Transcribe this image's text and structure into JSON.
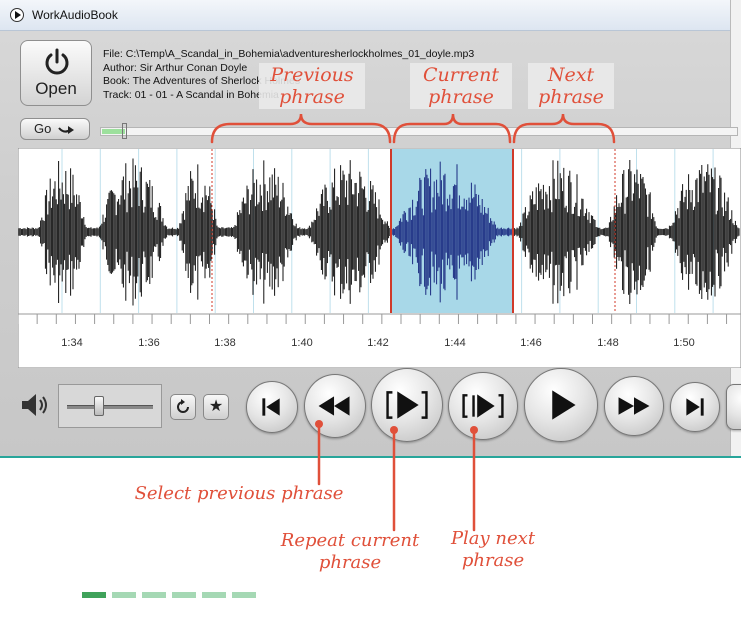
{
  "window": {
    "title": "WorkAudioBook"
  },
  "toolbar": {
    "open_label": "Open",
    "go_label": "Go"
  },
  "file_info": {
    "file": "File:  C:\\Temp\\A_Scandal_in_Bohemia\\adventuresherlockholmes_01_doyle.mp3",
    "author": "Author:  Sir Arthur Conan Doyle",
    "book": "Book:  The Adventures of Sherlock Holmes",
    "track": "Track:  01 - 01 - A Scandal in Bohemia"
  },
  "timeline": {
    "ticks": [
      "1:34",
      "1:36",
      "1:38",
      "1:40",
      "1:42",
      "1:44",
      "1:46",
      "1:48",
      "1:50"
    ]
  },
  "colors": {
    "accent": "#e0503a",
    "selection": "#a8d8e8",
    "wave": "#111111",
    "wave_current": "#1a2a80",
    "divider": "#27a59a"
  },
  "annotations": {
    "previous": "Previous\nphrase",
    "current": "Current\nphrase",
    "next": "Next\nphrase",
    "select_previous": "Select previous phrase",
    "repeat_current": "Repeat current\nphrase",
    "play_next": "Play next\nphrase"
  },
  "icons": {
    "open": "power-icon",
    "go": "arrow-right-icon",
    "volume": "speaker-icon",
    "loop": "loop-icon",
    "bookmark": "star-icon",
    "first": "skip-to-start-icon",
    "previous": "rewind-icon",
    "repeat": "repeat-phrase-icon",
    "play_next": "play-next-phrase-icon",
    "play": "play-icon",
    "forward": "fast-forward-icon",
    "last": "skip-to-end-icon"
  },
  "volume": {
    "level": 0.35
  },
  "progress": {
    "fraction": 0.036
  }
}
